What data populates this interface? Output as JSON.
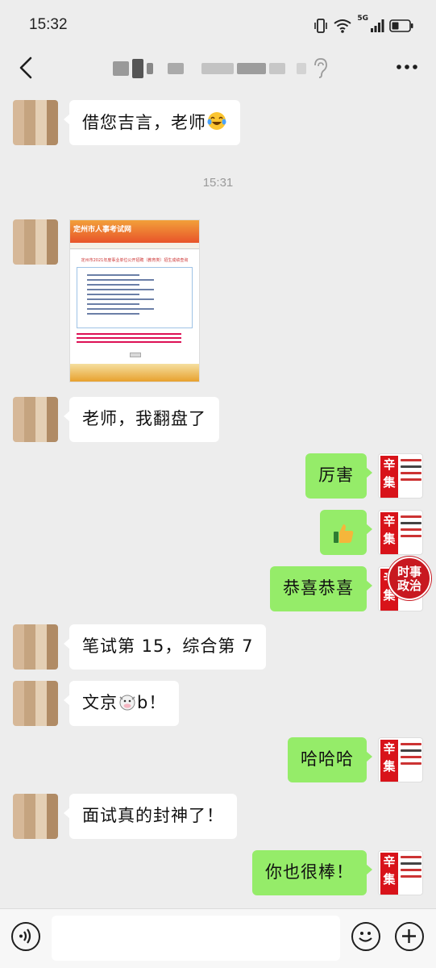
{
  "status_bar": {
    "time": "15:32",
    "network_label": "5G"
  },
  "header": {
    "back_icon": "chevron-left-icon",
    "more_icon": "more-dots-icon",
    "earpiece_icon": "ear-icon"
  },
  "conversation": {
    "timestamp": "15:31",
    "messages": [
      {
        "side": "in",
        "type": "text",
        "text": "借您吉言，老师",
        "emoji": "laughing-tears-emoji"
      },
      {
        "side": "in",
        "type": "image",
        "image_title": "定州市人事考试网",
        "image_desc": "定州市2021年度事业单位公开招聘（教育类）招生成绩查询"
      },
      {
        "side": "in",
        "type": "text",
        "text": "老师，我翻盘了"
      },
      {
        "side": "out",
        "type": "text",
        "text": "厉害"
      },
      {
        "side": "out",
        "type": "emoji",
        "emoji": "thumbs-up-emoji"
      },
      {
        "side": "out",
        "type": "text",
        "text": "恭喜恭喜"
      },
      {
        "side": "in",
        "type": "text",
        "text": "笔试第 15，综合第 7"
      },
      {
        "side": "in",
        "type": "text",
        "text_before": "文京",
        "emoji": "cow-emoji",
        "text_after": "b！"
      },
      {
        "side": "out",
        "type": "text",
        "text": "哈哈哈"
      },
      {
        "side": "in",
        "type": "text",
        "text": "面试真的封神了！"
      },
      {
        "side": "out",
        "type": "text",
        "text": "你也很棒！"
      }
    ]
  },
  "outgoing_avatar": {
    "brand_text": "辛集"
  },
  "floating_badge": {
    "text_line1": "时事",
    "text_line2": "政治"
  },
  "input_bar": {
    "voice_icon": "voice-icon",
    "emoji_icon": "smiley-icon",
    "plus_icon": "plus-icon",
    "input_value": ""
  },
  "colors": {
    "chat_background": "#ededed",
    "outgoing_bubble": "#95ec69",
    "incoming_bubble": "#ffffff",
    "brand_red": "#d8131a"
  }
}
